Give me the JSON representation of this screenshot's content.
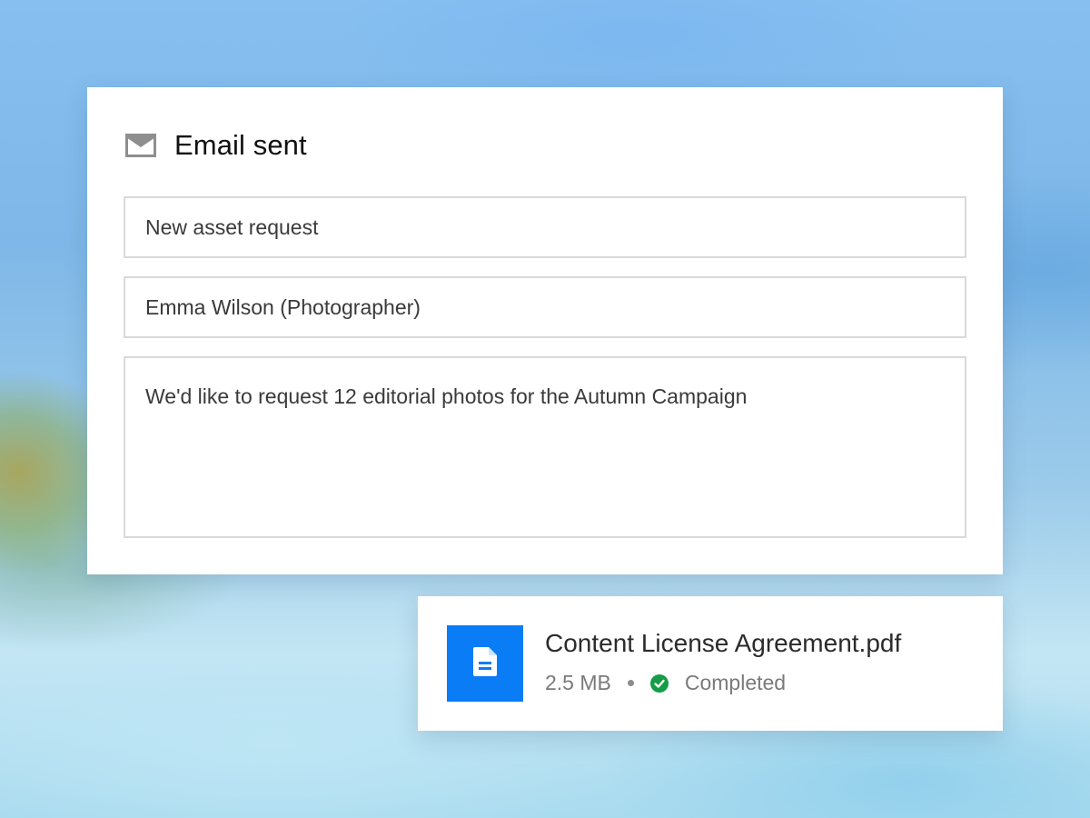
{
  "email": {
    "title": "Email sent",
    "icon": "mail-icon",
    "subject": "New asset request",
    "recipient": "Emma Wilson (Photographer)",
    "message": "We'd like to request 12 editorial photos for the Autumn Campaign"
  },
  "attachment": {
    "icon": "document-icon",
    "file_name": "Content License Agreement.pdf",
    "file_size": "2.5 MB",
    "status": "Completed",
    "status_icon": "check-circle-icon"
  },
  "colors": {
    "file_accent": "#0a7cf5",
    "status_success": "#169c47",
    "icon_gray": "#8e8e8e"
  }
}
